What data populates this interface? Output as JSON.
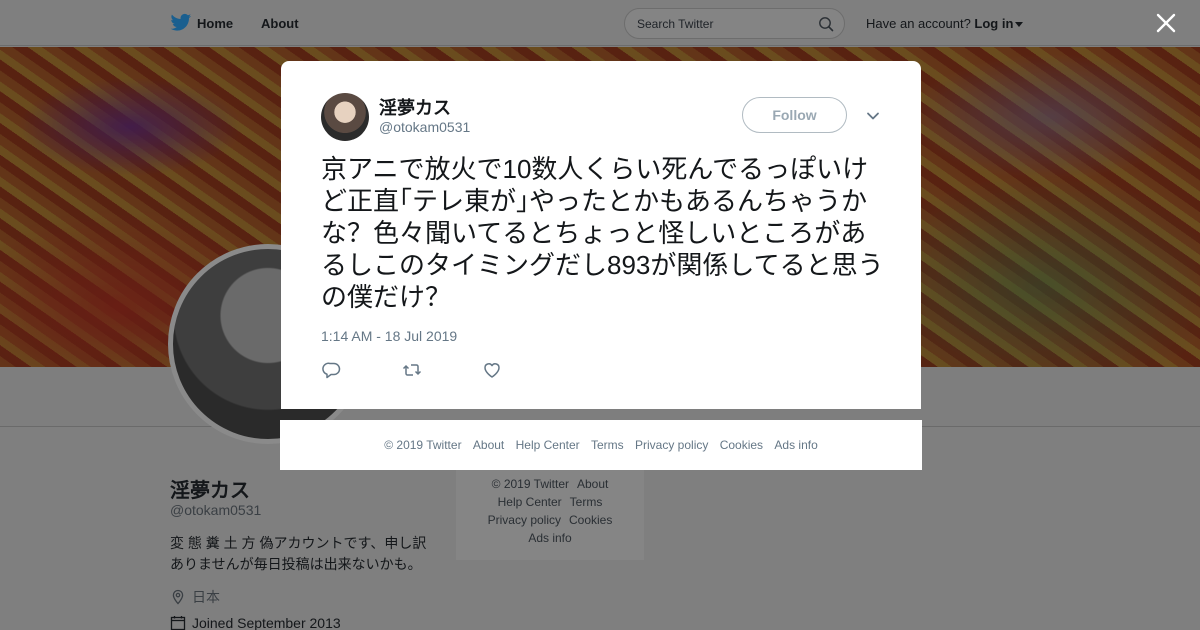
{
  "nav": {
    "home_label": "Home",
    "about_label": "About",
    "search_placeholder": "Search Twitter",
    "account_prompt": "Have an account?",
    "login_label": "Log in"
  },
  "profile": {
    "name": "淫夢カス",
    "handle": "@otokam0531",
    "bio": "変 態 糞 土 方 偽アカウントです、申し訳ありませんが毎日投稿は出来ないかも。",
    "location": "日本",
    "joined": "Joined September 2013"
  },
  "side_footer": {
    "links": [
      "© 2019 Twitter",
      "About",
      "Help Center",
      "Terms",
      "Privacy policy",
      "Cookies",
      "Ads info"
    ]
  },
  "tweet": {
    "author_name": "淫夢カス",
    "author_handle": "@otokam0531",
    "follow_label": "Follow",
    "text": "京アニで放火で10数人くらい死んでるっぽいけど正直｢テレ東が｣やったとかもあるんちゃうかな？色々聞いてるとちょっと怪しいところがあるしこのタイミングだし893が関係してると思うの僕だけ？",
    "timestamp": "1:14 AM - 18 Jul 2019"
  },
  "modal_footer": {
    "links": [
      "© 2019 Twitter",
      "About",
      "Help Center",
      "Terms",
      "Privacy policy",
      "Cookies",
      "Ads info"
    ]
  },
  "colors": {
    "overlay": "#7f7f7f",
    "link_gray": "#657786",
    "follow_border": "#b1bbc2"
  },
  "icons": [
    "twitter-bird-icon",
    "search-icon",
    "close-icon",
    "chevron-down-icon",
    "reply-icon",
    "retweet-icon",
    "like-icon",
    "location-icon",
    "calendar-icon"
  ]
}
